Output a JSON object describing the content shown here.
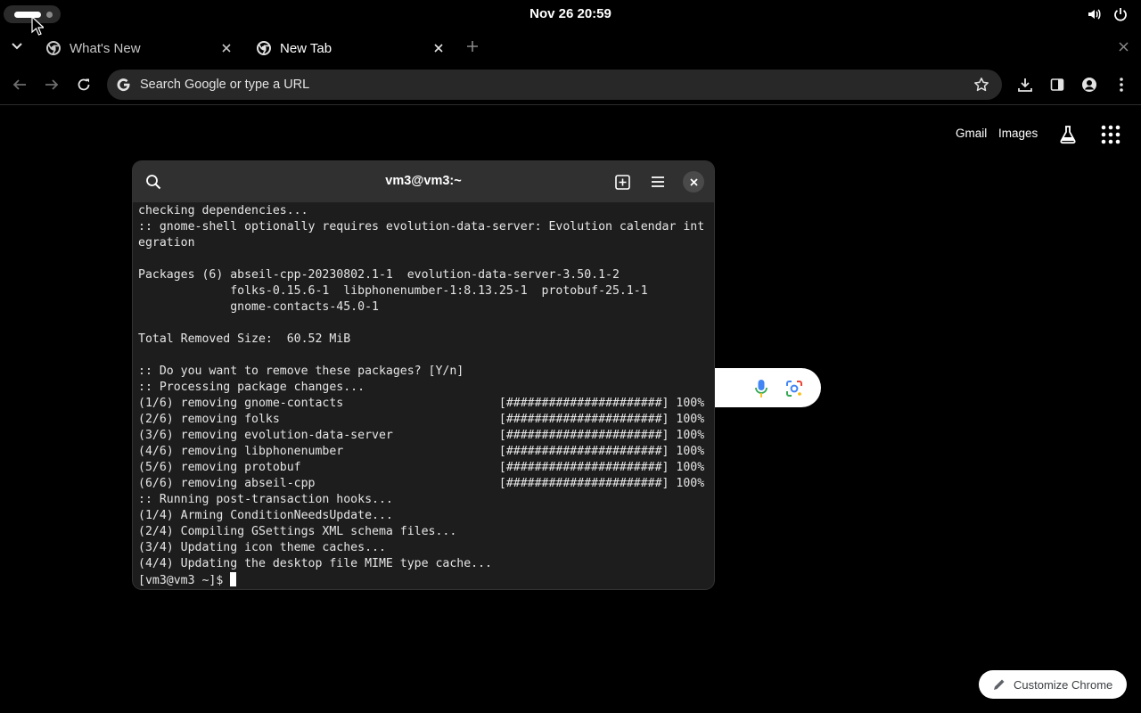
{
  "topbar": {
    "clock": "Nov 26  20:59"
  },
  "browser": {
    "tabs": [
      {
        "title": "What's New",
        "active": false
      },
      {
        "title": "New Tab",
        "active": true
      }
    ],
    "omnibox": {
      "placeholder": "Search Google or type a URL"
    },
    "ntp": {
      "gmail_link": "Gmail",
      "images_link": "Images",
      "customize_button": "Customize Chrome"
    }
  },
  "terminal": {
    "title": "vm3@vm3:~",
    "lines": [
      "checking dependencies...",
      ":: gnome-shell optionally requires evolution-data-server: Evolution calendar int",
      "egration",
      "",
      "Packages (6) abseil-cpp-20230802.1-1  evolution-data-server-3.50.1-2",
      "             folks-0.15.6-1  libphonenumber-1:8.13.25-1  protobuf-25.1-1",
      "             gnome-contacts-45.0-1",
      "",
      "Total Removed Size:  60.52 MiB",
      "",
      ":: Do you want to remove these packages? [Y/n]",
      ":: Processing package changes...",
      "(1/6) removing gnome-contacts                      [######################] 100%",
      "(2/6) removing folks                               [######################] 100%",
      "(3/6) removing evolution-data-server               [######################] 100%",
      "(4/6) removing libphonenumber                      [######################] 100%",
      "(5/6) removing protobuf                            [######################] 100%",
      "(6/6) removing abseil-cpp                          [######################] 100%",
      ":: Running post-transaction hooks...",
      "(1/4) Arming ConditionNeedsUpdate...",
      "(2/4) Compiling GSettings XML schema files...",
      "(3/4) Updating icon theme caches...",
      "(4/4) Updating the desktop file MIME type cache..."
    ],
    "prompt": "[vm3@vm3 ~]$ "
  }
}
